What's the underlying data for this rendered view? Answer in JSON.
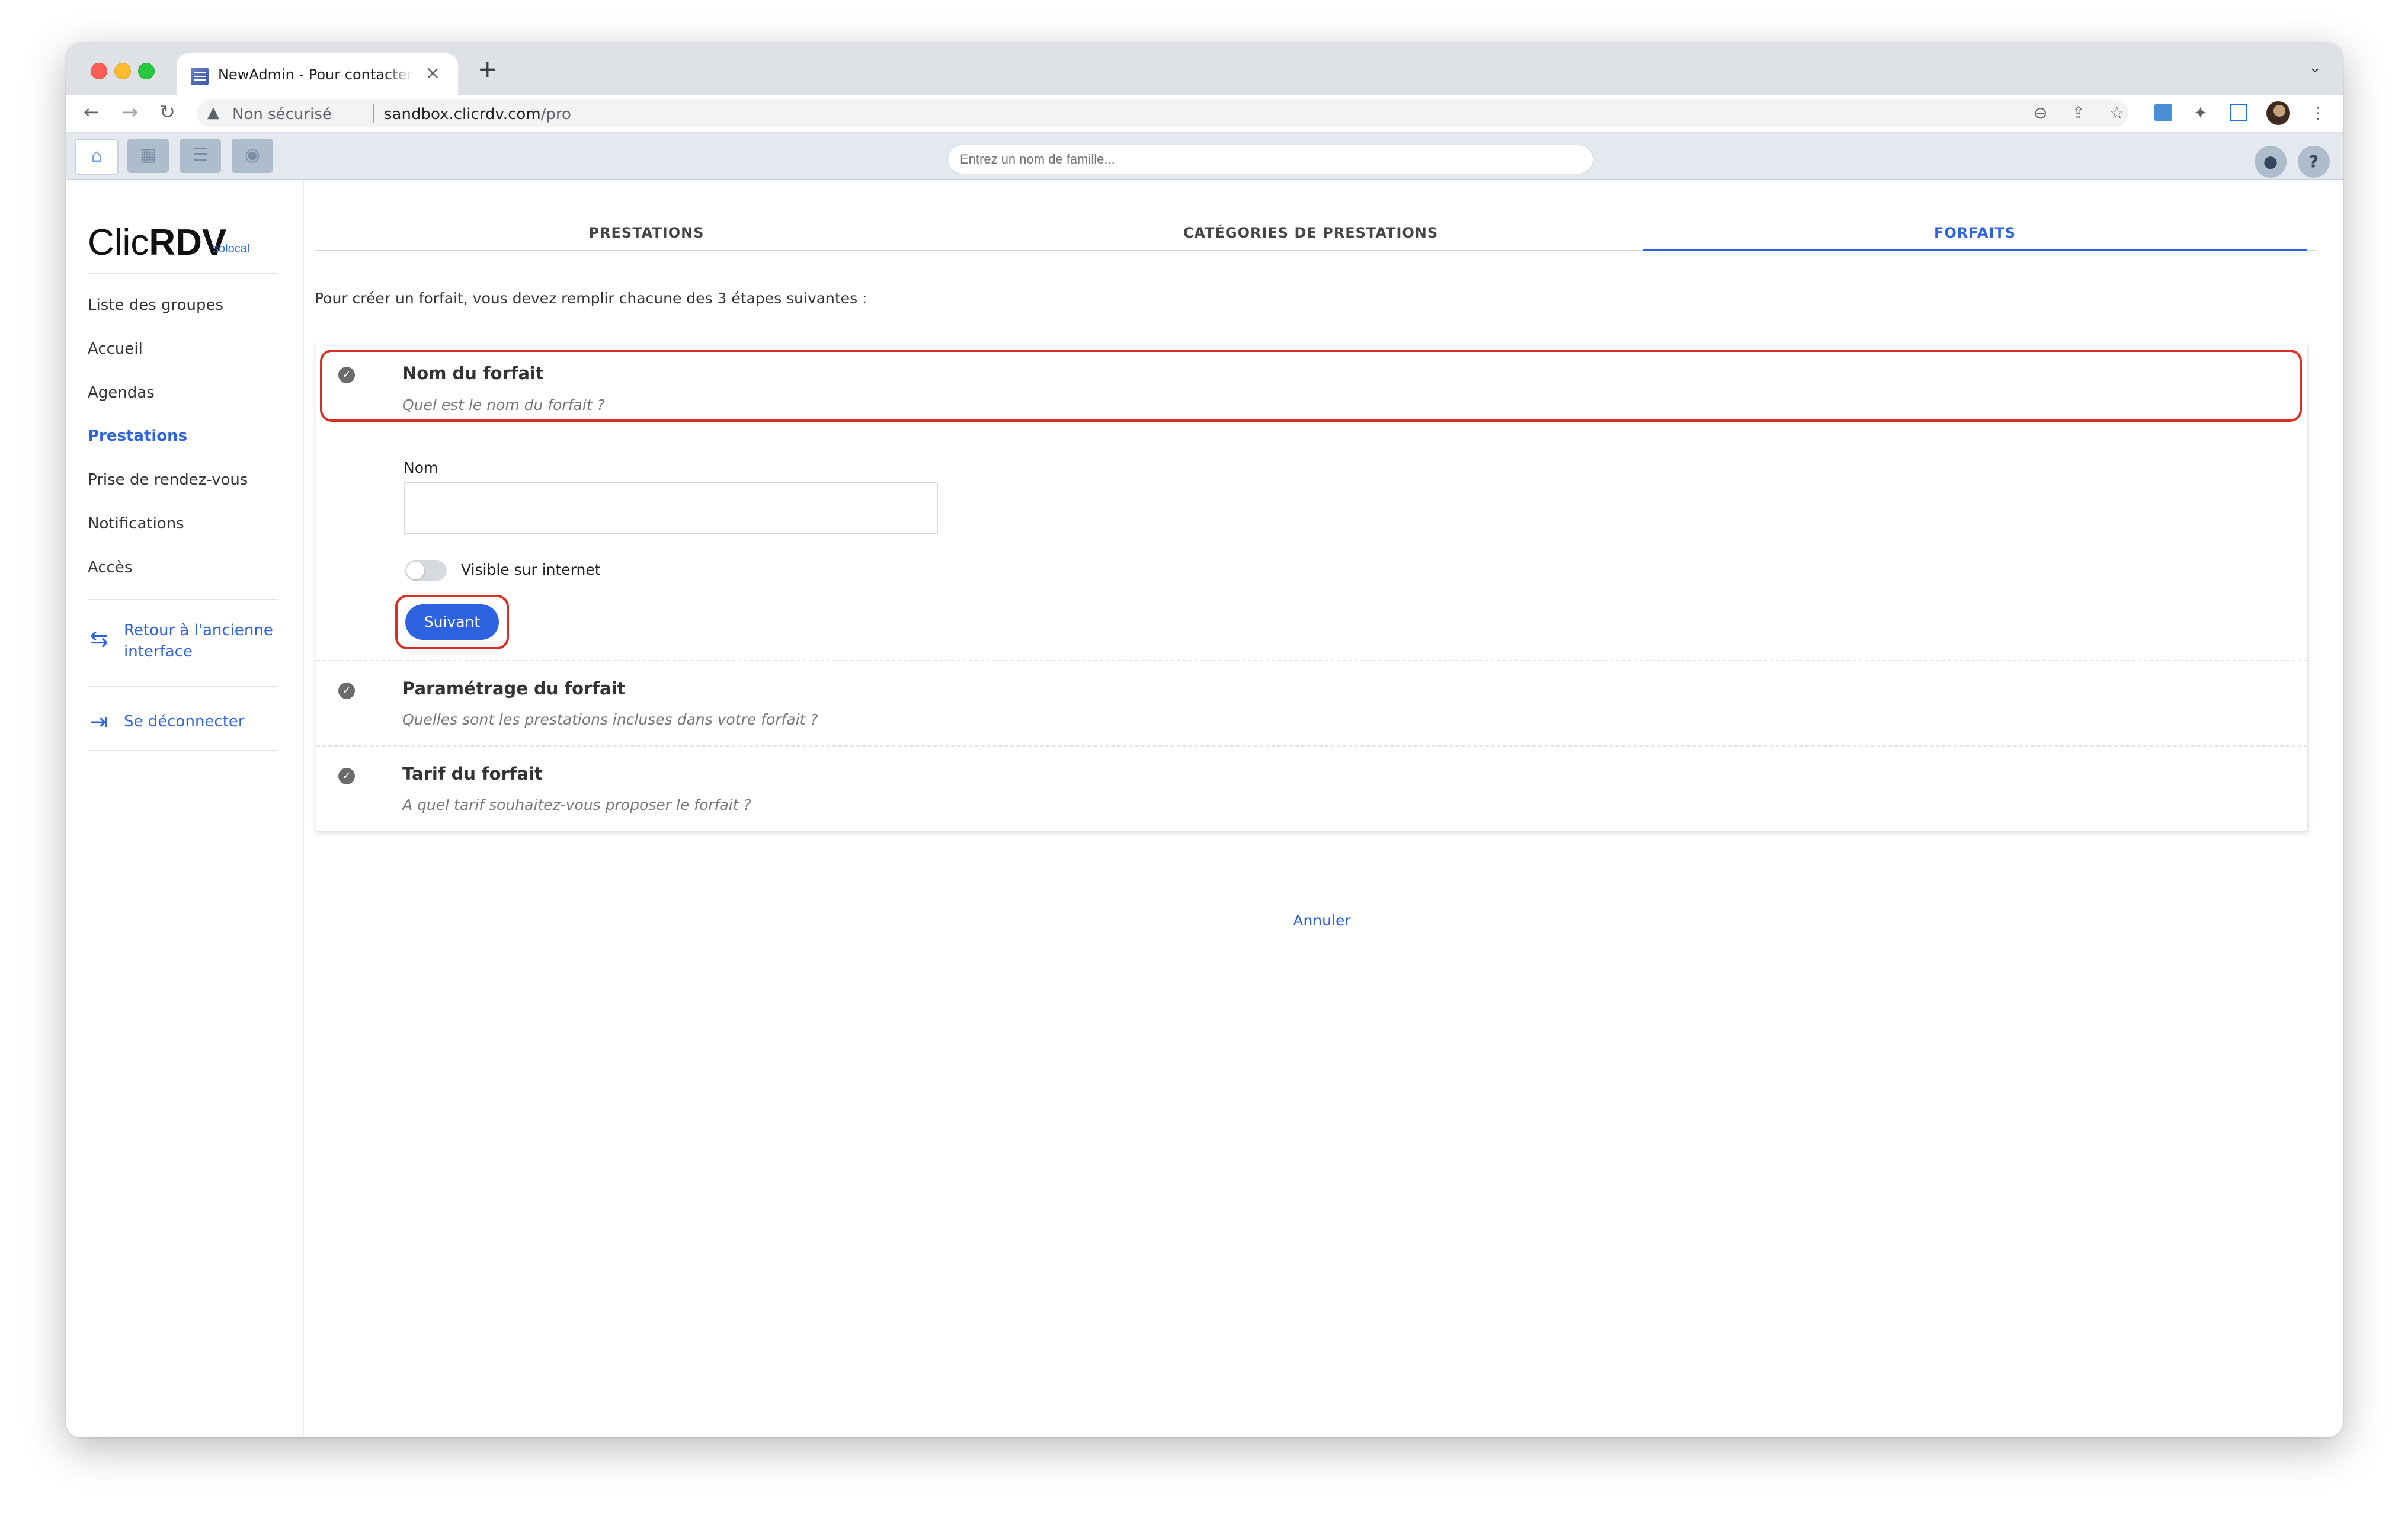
{
  "browser": {
    "tab_title": "NewAdmin - Pour contacter Cl",
    "tab_close": "×",
    "new_tab": "+",
    "tab_dropdown": "⌄",
    "nav": {
      "back": "←",
      "forward": "→",
      "reload": "↻"
    },
    "security_warning_icon": "▲",
    "security_label": "Non sécurisé",
    "url_domain": "sandbox.clicrdv.com",
    "url_path": "/pro",
    "toolbar_icons": {
      "zoom": "⊖",
      "share": "⇪",
      "bookmark": "☆",
      "puzzle": "✦",
      "menu": "⋮"
    }
  },
  "appbar": {
    "icons": [
      "home-icon",
      "calendar-icon",
      "list-icon",
      "globe-icon"
    ],
    "icon_glyphs": [
      "⌂",
      "▦",
      "☰",
      "◉"
    ],
    "search_placeholder": "Entrez un nom de famille...",
    "user_glyph": "●",
    "help_glyph": "?"
  },
  "sidebar": {
    "logo_light": "Clic",
    "logo_bold": "RDV",
    "logo_sub": "solocal",
    "items": [
      {
        "label": "Liste des groupes",
        "active": false
      },
      {
        "label": "Accueil",
        "active": false
      },
      {
        "label": "Agendas",
        "active": false
      },
      {
        "label": "Prestations",
        "active": true
      },
      {
        "label": "Prise de rendez-vous",
        "active": false
      },
      {
        "label": "Notifications",
        "active": false
      },
      {
        "label": "Accès",
        "active": false
      }
    ],
    "back_link_line1": "Retour à l'ancienne",
    "back_link_line2": "interface",
    "back_icon": "⇆",
    "logout_link": "Se déconnecter",
    "logout_icon": "⇥"
  },
  "main": {
    "tabs": [
      {
        "label": "PRESTATIONS",
        "active": false
      },
      {
        "label": "CATÉGORIES DE PRESTATIONS",
        "active": false
      },
      {
        "label": "FORFAITS",
        "active": true
      }
    ],
    "intro": "Pour créer un forfait, vous devez remplir chacune des 3 étapes suivantes :",
    "steps": [
      {
        "title": "Nom du forfait",
        "subtitle": "Quel est le nom du forfait ?"
      },
      {
        "title": "Paramétrage du forfait",
        "subtitle": "Quelles sont les prestations incluses dans votre forfait ?"
      },
      {
        "title": "Tarif du forfait",
        "subtitle": "A quel tarif souhaitez-vous proposer le forfait ?"
      }
    ],
    "check_glyph": "✓",
    "form": {
      "name_label": "Nom",
      "name_value": "",
      "visible_label": "Visible sur internet",
      "visible_on": false,
      "next_button": "Suivant"
    },
    "cancel": "Annuler"
  },
  "colors": {
    "accent": "#2d62e0",
    "highlight": "#d93025",
    "appbar_bg": "#e4e9f0"
  }
}
